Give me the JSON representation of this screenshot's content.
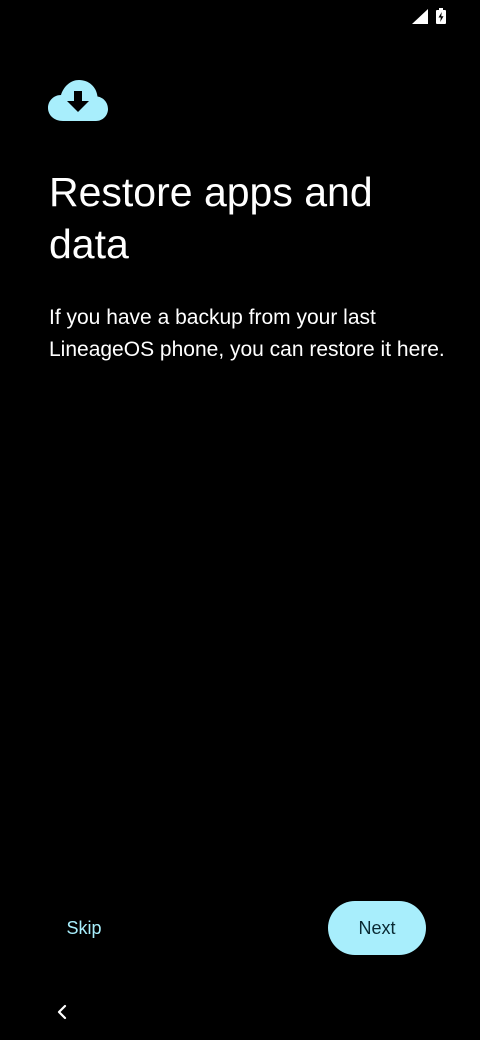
{
  "status_bar": {
    "icons": [
      "signal-icon",
      "battery-charging-icon"
    ]
  },
  "header": {
    "icon": "cloud-download-icon",
    "title": "Restore apps and data"
  },
  "body": {
    "description": "If you have a backup from your last LineageOS phone, you can restore it here."
  },
  "footer": {
    "skip_label": "Skip",
    "next_label": "Next"
  },
  "nav_bar": {
    "back_icon": "back-chevron-icon"
  },
  "colors": {
    "background": "#000000",
    "accent": "#a8eefc",
    "text": "#ffffff",
    "button_text": "#0a2a33"
  }
}
